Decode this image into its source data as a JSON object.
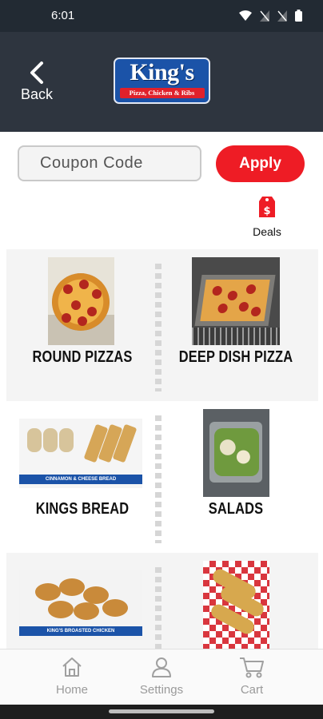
{
  "status_bar": {
    "time": "6:01"
  },
  "header": {
    "back_label": "Back",
    "logo_name": "King's",
    "logo_tagline": "Pizza, Chicken & Ribs"
  },
  "coupon": {
    "placeholder": "Coupon Code",
    "apply_label": "Apply"
  },
  "deals": {
    "label": "Deals"
  },
  "menu": {
    "items": [
      {
        "label": "ROUND PIZZAS"
      },
      {
        "label": "DEEP DISH PIZZA"
      },
      {
        "label": "KINGS BREAD",
        "image_banner": "CINNAMON & CHEESE BREAD"
      },
      {
        "label": "SALADS"
      },
      {
        "label": "",
        "image_banner": "KING'S BROASTED CHICKEN"
      },
      {
        "label": ""
      }
    ]
  },
  "bottom_nav": {
    "home_label": "Home",
    "settings_label": "Settings",
    "cart_label": "Cart"
  },
  "colors": {
    "header_bg": "#2e353f",
    "accent": "#ee1c25",
    "logo_blue": "#1b53a8"
  }
}
